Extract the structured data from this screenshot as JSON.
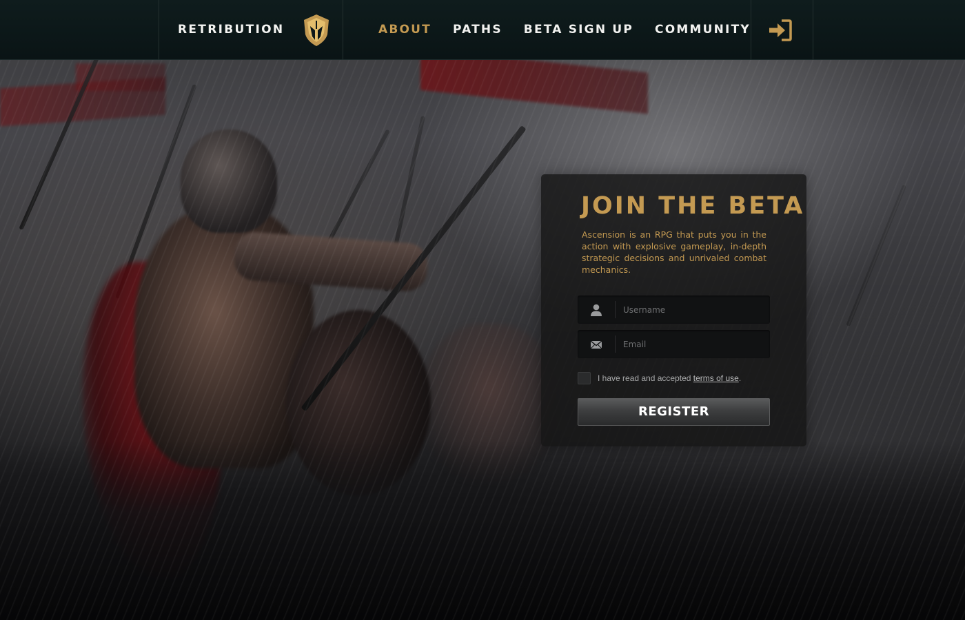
{
  "header": {
    "brand": "RETRIBUTION",
    "nav": [
      {
        "label": "ABOUT",
        "active": true
      },
      {
        "label": "PATHS",
        "active": false
      },
      {
        "label": "BETA SIGN UP",
        "active": false
      },
      {
        "label": "COMMUNITY",
        "active": false
      }
    ],
    "login_icon": "sign-in-icon",
    "brand_icon": "shield-helmet-icon"
  },
  "signup": {
    "title": "JOIN THE BETA",
    "description": "Ascension is an RPG that puts you in the action with explosive gameplay, in-depth strategic decisions and unrivaled combat mechanics.",
    "username": {
      "placeholder": "Username",
      "value": "",
      "icon": "user-icon"
    },
    "email": {
      "placeholder": "Email",
      "value": "",
      "icon": "envelope-icon"
    },
    "terms": {
      "prefix": "I have read and accepted ",
      "link": "terms of use",
      "suffix": ".",
      "checked": false
    },
    "register_label": "REGISTER"
  },
  "colors": {
    "accent": "#c49a52",
    "header_bg": "#0f1c1d",
    "card_bg": "#161616",
    "nav_text": "#f2f2f0"
  }
}
